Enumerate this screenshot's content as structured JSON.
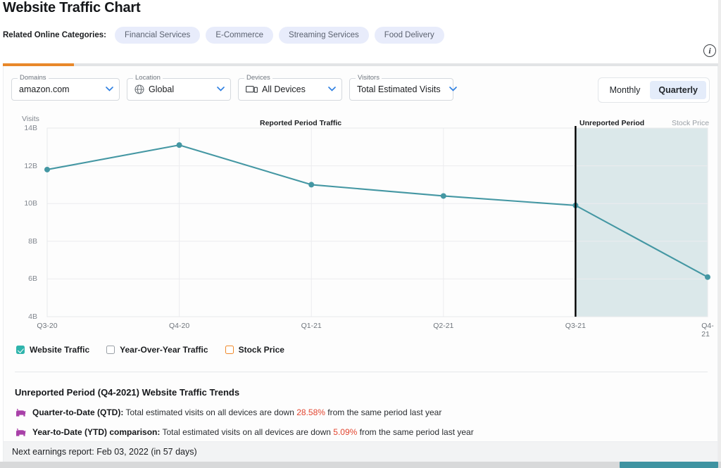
{
  "header": {
    "title": "Website Traffic Chart",
    "categories_label": "Related Online Categories:",
    "categories": [
      "Financial Services",
      "E-Commerce",
      "Streaming Services",
      "Food Delivery"
    ],
    "info_icon": "info-icon",
    "info_glyph": "i"
  },
  "filters": [
    {
      "label": "Domains",
      "value": "amazon.com",
      "icon": "",
      "chevron": "∨"
    },
    {
      "label": "Location",
      "value": "Global",
      "icon": "globe-icon",
      "chevron": "∨"
    },
    {
      "label": "Devices",
      "value": "All Devices",
      "icon": "devices-icon",
      "chevron": "∨"
    },
    {
      "label": "Visitors",
      "value": "Total Estimated Visits",
      "icon": "",
      "chevron": "∨"
    }
  ],
  "granularity": {
    "options": [
      "Monthly",
      "Quarterly"
    ],
    "selected": "Quarterly"
  },
  "chart_labels": {
    "y_axis_title": "Visits",
    "reported_period": "Reported Period Traffic",
    "unreported_period": "Unreported Period",
    "stock_price": "Stock Price"
  },
  "chart_data": {
    "type": "line",
    "title": "Reported Period Traffic",
    "xlabel": "",
    "ylabel": "Visits",
    "categories": [
      "Q3-20",
      "Q4-20",
      "Q1-21",
      "Q2-21",
      "Q3-21",
      "Q4-21"
    ],
    "series": [
      {
        "name": "Website Traffic",
        "values": [
          11.8,
          13.1,
          11.0,
          10.4,
          9.9,
          6.1
        ],
        "color": "#4497a3"
      }
    ],
    "ylim": [
      4,
      14
    ],
    "yticks": [
      14,
      12,
      10,
      8,
      6,
      4
    ],
    "ytick_labels": [
      "14B",
      "12B",
      "10B",
      "8B",
      "6B",
      "4B"
    ],
    "grid": true,
    "legend_position": "below",
    "shaded_region": {
      "label": "Unreported Period",
      "from": "Q3-21",
      "to": "Q4-21",
      "color": "#dbe8ea"
    },
    "divider_line": {
      "at": "Q3-21",
      "color": "#000000"
    }
  },
  "legend": [
    {
      "label": "Website Traffic",
      "checked": true,
      "style": "teal"
    },
    {
      "label": "Year-Over-Year Traffic",
      "checked": false,
      "style": "empty"
    },
    {
      "label": "Stock Price",
      "checked": false,
      "style": "orange"
    }
  ],
  "trends": {
    "title": "Unreported Period (Q4-2021) Website Traffic Trends",
    "rows": [
      {
        "icon": "bear-icon",
        "label": "Quarter-to-Date (QTD):",
        "text_before": " Total estimated visits on all devices are down ",
        "percent": "28.58%",
        "text_after": " from the same period last year"
      },
      {
        "icon": "bear-icon",
        "label": "Year-to-Date (YTD) comparison:",
        "text_before": " Total estimated visits on all devices are down ",
        "percent": "5.09%",
        "text_after": " from the same period last year"
      }
    ]
  },
  "footer": {
    "text": "Next earnings report: Feb 03, 2022 (in 57 days)"
  },
  "colors": {
    "accent_orange": "#e8882a",
    "line_teal": "#4497a3",
    "negative_red": "#e2452f",
    "shade": "#dbe8ea"
  }
}
